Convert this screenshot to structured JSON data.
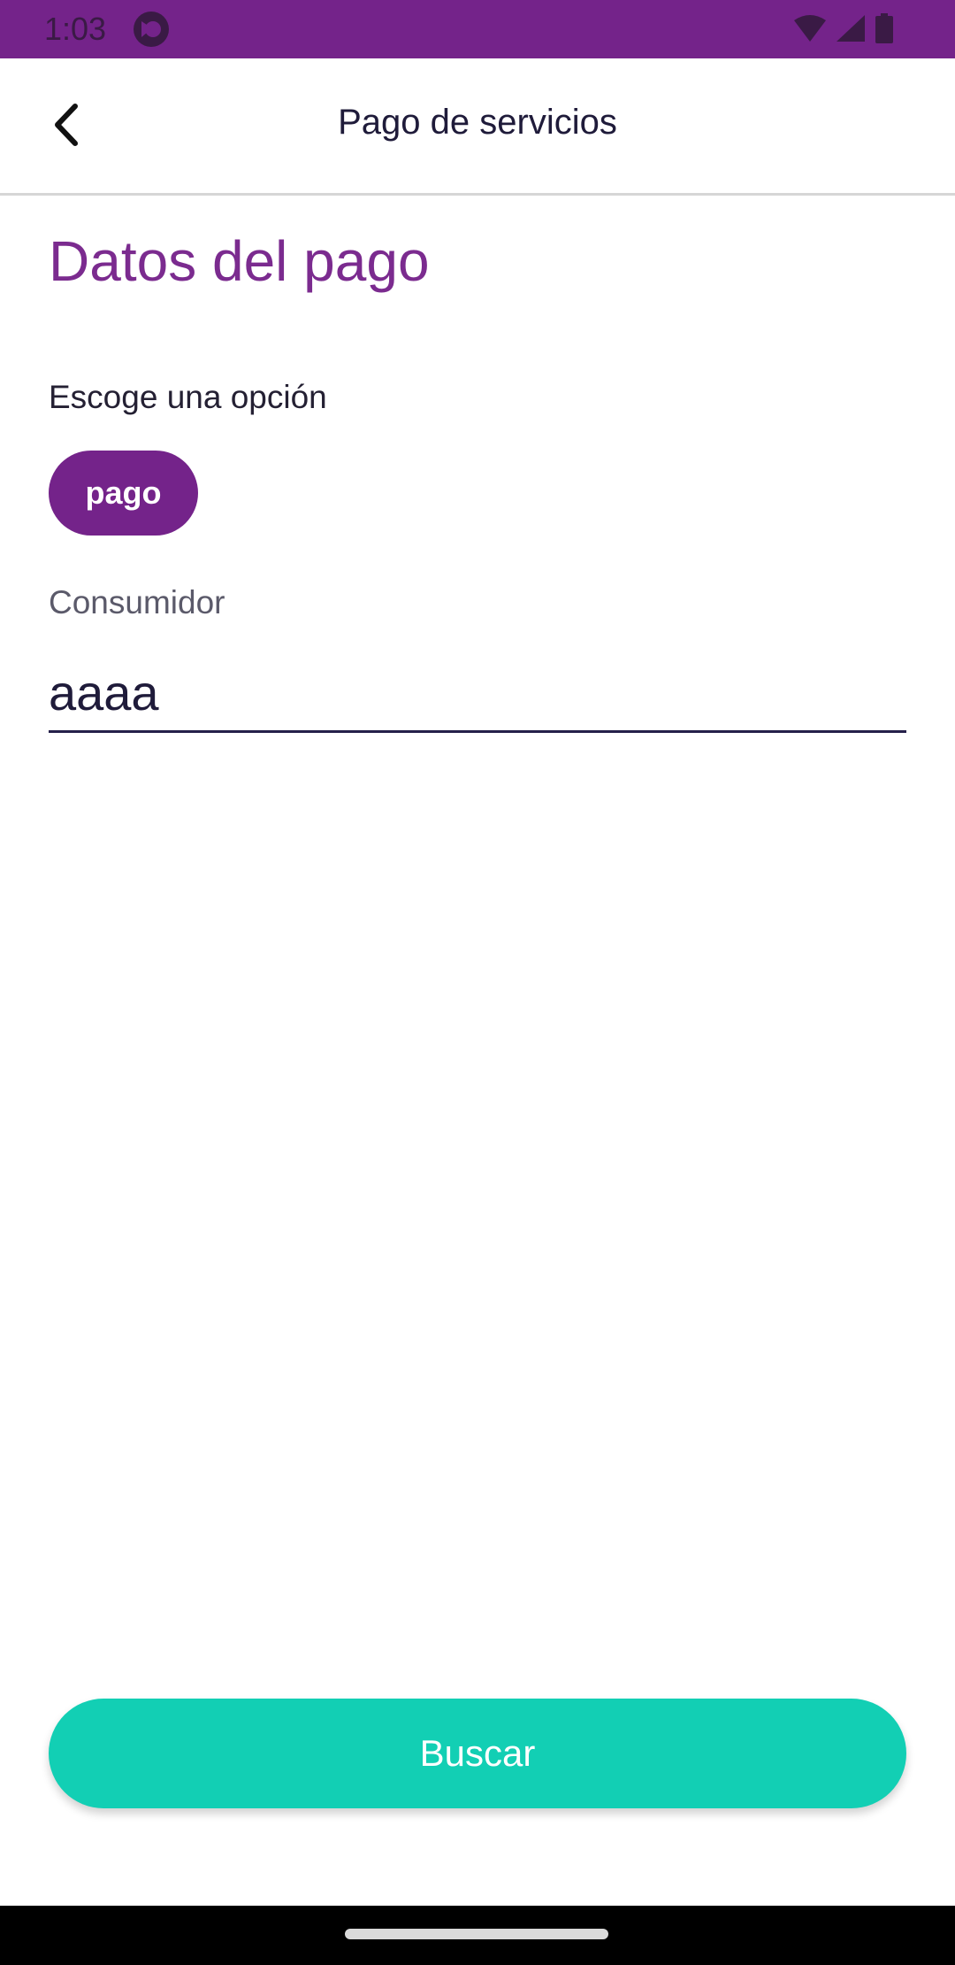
{
  "status_bar": {
    "time": "1:03",
    "icons": [
      "app-notification-icon",
      "wifi-icon",
      "signal-icon",
      "battery-icon"
    ],
    "color": "#74238a"
  },
  "appbar": {
    "title": "Pago de servicios",
    "back_icon": "chevron-left-icon"
  },
  "form": {
    "section_title": "Datos del pago",
    "option_label": "Escoge una opción",
    "selected_option": "pago",
    "consumer_label": "Consumidor",
    "consumer_value": "aaaa"
  },
  "actions": {
    "search_label": "Buscar"
  },
  "colors": {
    "brand": "#74238a",
    "title": "#7b2b8f",
    "accent": "#12cfb4"
  }
}
